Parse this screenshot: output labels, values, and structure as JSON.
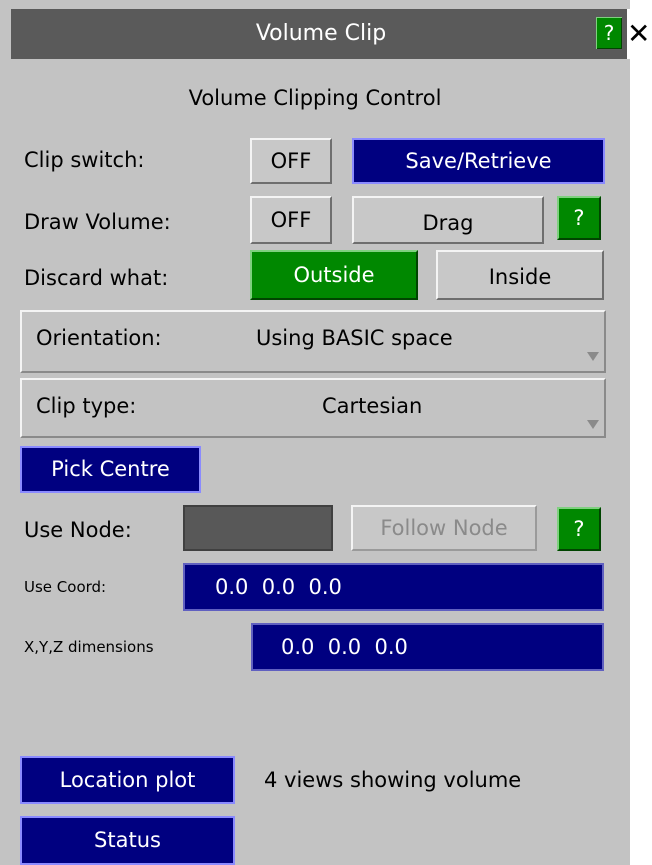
{
  "window": {
    "title": "Volume Clip",
    "help": "?",
    "close": "✕"
  },
  "heading": "Volume Clipping Control",
  "clip_switch": {
    "label": "Clip switch:",
    "state": "OFF",
    "save": "Save/Retrieve"
  },
  "draw_volume": {
    "label": "Draw Volume:",
    "state": "OFF",
    "drag": "Drag",
    "help": "?"
  },
  "discard": {
    "label": "Discard what:",
    "outside": "Outside",
    "inside": "Inside",
    "selected": "Outside"
  },
  "orientation": {
    "label": "Orientation:",
    "value": "Using BASIC space"
  },
  "clip_type": {
    "label": "Clip type:",
    "value": "Cartesian"
  },
  "pick_centre": "Pick Centre",
  "use_node": {
    "label": "Use Node:",
    "follow": "Follow Node",
    "help": "?"
  },
  "use_coord": {
    "label": "Use Coord:",
    "value": "0.0  0.0  0.0"
  },
  "dimensions": {
    "label": "X,Y,Z dimensions",
    "value": "0.0  0.0  0.0"
  },
  "location_plot": {
    "button": "Location plot",
    "status_text": "4 views showing volume"
  },
  "status": "Status",
  "colors": {
    "panel": "#c3c3c3",
    "navy": "#000080",
    "green": "#008800",
    "titlebar": "#5a5a5a"
  }
}
